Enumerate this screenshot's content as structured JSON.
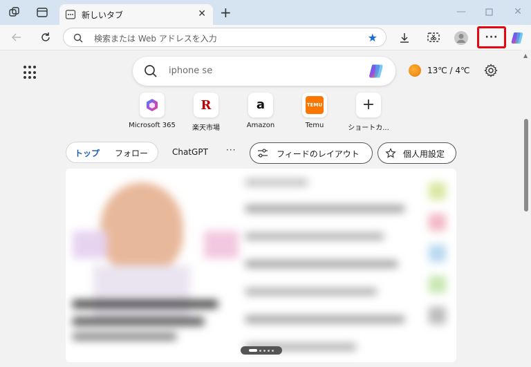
{
  "tab": {
    "title": "新しいタブ"
  },
  "address_bar": {
    "placeholder": "検索または Web アドレスを入力"
  },
  "search": {
    "value": "iphone se"
  },
  "weather": {
    "text": "13℃ / 4℃"
  },
  "quick_links": [
    {
      "label": "Microsoft 365",
      "icon": "microsoft-365-icon"
    },
    {
      "label": "楽天市場",
      "icon": "rakuten-icon",
      "glyph": "R"
    },
    {
      "label": "Amazon",
      "icon": "amazon-icon",
      "glyph": "a"
    },
    {
      "label": "Temu",
      "icon": "temu-icon",
      "glyph": "TEMU"
    },
    {
      "label": "ショートカ...",
      "icon": "add-shortcut-icon",
      "glyph": "+"
    }
  ],
  "feed_nav": {
    "top": "トップ",
    "follow": "フォロー",
    "chatgpt": "ChatGPT",
    "more": "···",
    "feed_layout": "フィードのレイアウト",
    "personalize": "個人用設定"
  },
  "toolbar": {
    "more_label": "···"
  },
  "colors": {
    "accent": "#1a5fb4",
    "highlight": "#e30613",
    "titlebar": "#d6e4f2"
  }
}
